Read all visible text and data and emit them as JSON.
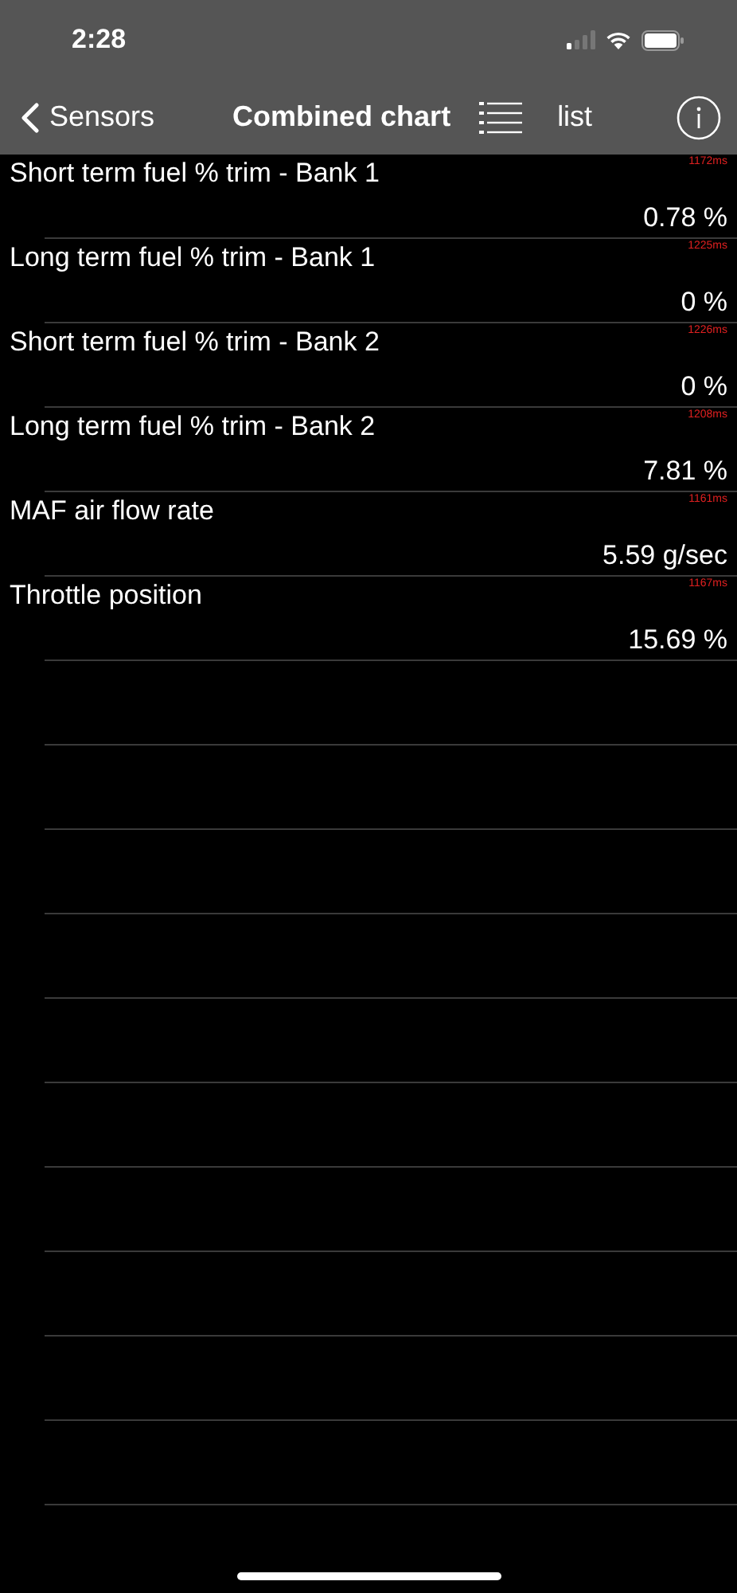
{
  "status_bar": {
    "time": "2:28"
  },
  "nav_bar": {
    "back": "Sensors",
    "title": "Combined chart",
    "list_button": "list"
  },
  "sensors": [
    {
      "name": "Short term fuel % trim - Bank 1",
      "value": "0.78 %",
      "latency": "1172ms"
    },
    {
      "name": "Long term fuel % trim - Bank 1",
      "value": "0 %",
      "latency": "1225ms"
    },
    {
      "name": "Short term fuel % trim - Bank 2",
      "value": "0 %",
      "latency": "1226ms"
    },
    {
      "name": "Long term fuel % trim - Bank 2",
      "value": "7.81 %",
      "latency": "1208ms"
    },
    {
      "name": "MAF air flow rate",
      "value": "5.59 g/sec",
      "latency": "1161ms"
    },
    {
      "name": "Throttle position",
      "value": "15.69 %",
      "latency": "1167ms"
    }
  ]
}
